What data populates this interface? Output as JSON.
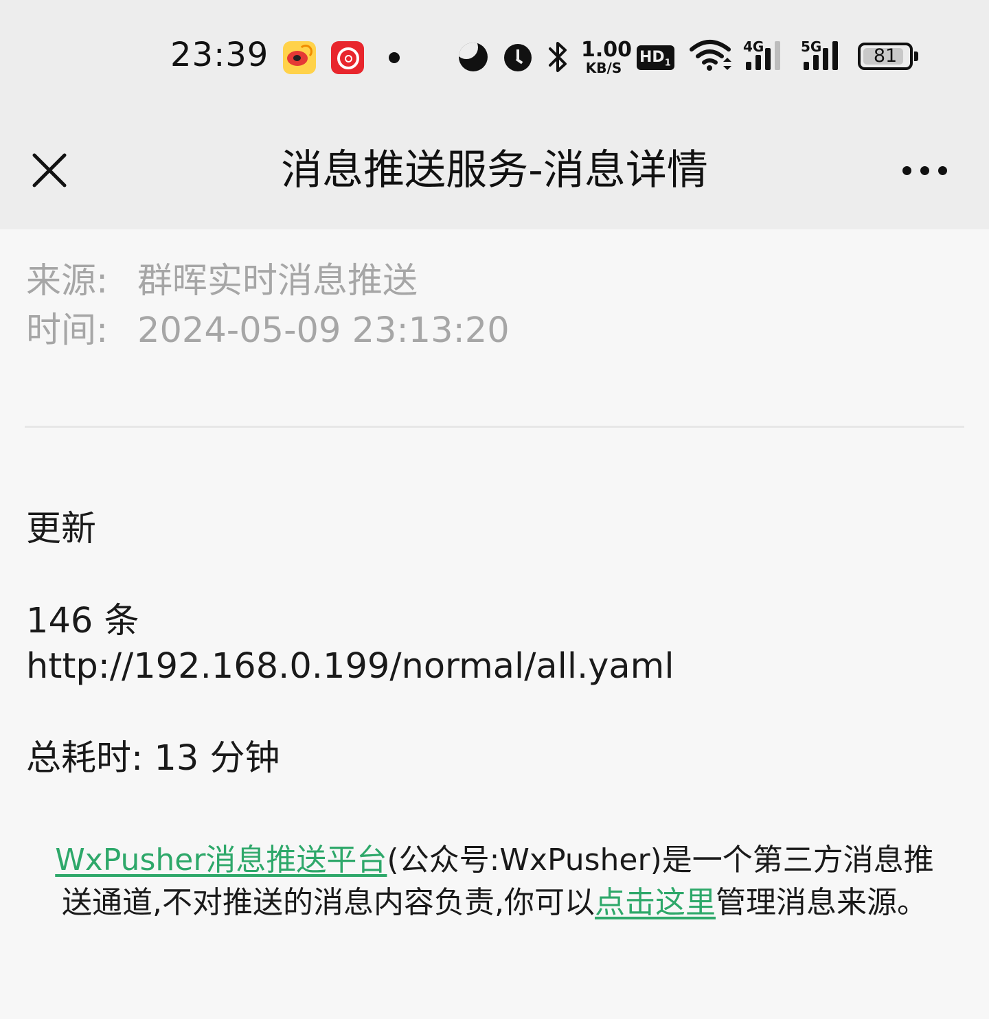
{
  "status_bar": {
    "time": "23:39",
    "notification_icons": [
      "weibo-icon",
      "netease-cloud-music-icon"
    ],
    "net_speed_value": "1.00",
    "net_speed_unit": "KB/S",
    "hd_label": "HD",
    "signal_1_label": "4G",
    "signal_2_label": "5G",
    "battery_level": "81",
    "colors": {
      "weibo": "#ffd24a",
      "netease": "#e8262d"
    }
  },
  "nav": {
    "title": "消息推送服务-消息详情",
    "close_icon": "close-icon",
    "more_icon": "more-icon"
  },
  "meta": {
    "source_label": "来源:",
    "source_value": "群晖实时消息推送",
    "time_label": "时间:",
    "time_value": "2024-05-09 23:13:20"
  },
  "message": {
    "heading": "更新",
    "count_line": "146 条",
    "url_line": "http://192.168.0.199/normal/all.yaml",
    "duration_line": "总耗时: 13 分钟"
  },
  "footer": {
    "platform_link": "WxPusher消息推送平台",
    "text_1": "(公众号:WxPusher)是一个第三方消息推送通道,不对推送的消息内容负责,你可以",
    "manage_link": "点击这里",
    "text_2": "管理消息来源。",
    "link_color": "#2ea86a"
  }
}
